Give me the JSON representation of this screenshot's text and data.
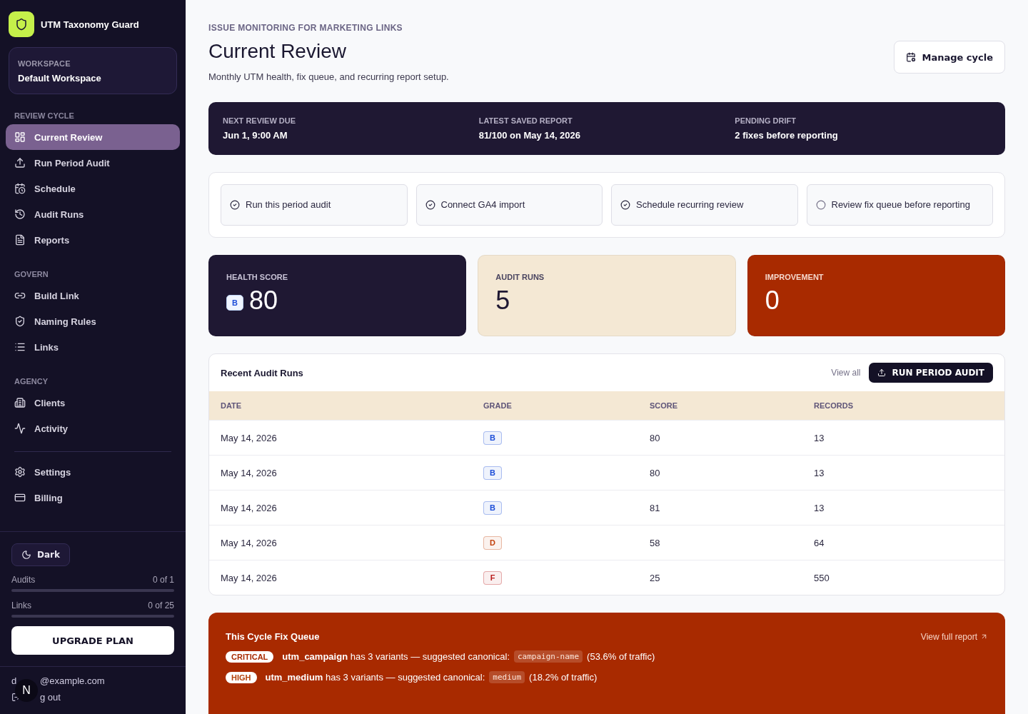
{
  "brand": {
    "name": "UTM Taxonomy Guard"
  },
  "workspace": {
    "label": "WORKSPACE",
    "name": "Default Workspace"
  },
  "nav_sections": [
    {
      "title": "REVIEW CYCLE",
      "items": [
        {
          "label": "Current Review",
          "selected": true
        },
        {
          "label": "Run Period Audit",
          "selected": false
        },
        {
          "label": "Schedule",
          "selected": false
        },
        {
          "label": "Audit Runs",
          "selected": false
        },
        {
          "label": "Reports",
          "selected": false
        }
      ]
    },
    {
      "title": "GOVERN",
      "items": [
        {
          "label": "Build Link",
          "selected": false
        },
        {
          "label": "Naming Rules",
          "selected": false
        },
        {
          "label": "Links",
          "selected": false
        }
      ]
    },
    {
      "title": "AGENCY",
      "items": [
        {
          "label": "Clients",
          "selected": false
        },
        {
          "label": "Activity",
          "selected": false
        }
      ]
    }
  ],
  "nav_footer_items": [
    {
      "label": "Settings",
      "selected": false
    },
    {
      "label": "Billing",
      "selected": false
    }
  ],
  "theme_button": "Dark",
  "usage": [
    {
      "label": "Audits",
      "reading": "0 of 1"
    },
    {
      "label": "Links",
      "reading": "0 of 25"
    }
  ],
  "upgrade_button": "UPGRADE PLAN",
  "account": {
    "email_start": "d",
    "email_end": "@example.com",
    "logout": "g out",
    "badge": "N"
  },
  "header": {
    "eyebrow": "ISSUE MONITORING FOR MARKETING LINKS",
    "title": "Current Review",
    "subtitle": "Monthly UTM health, fix queue, and recurring report setup.",
    "button": "Manage cycle"
  },
  "summary": [
    {
      "label": "NEXT REVIEW DUE",
      "value": "Jun 1, 9:00 AM"
    },
    {
      "label": "LATEST SAVED REPORT",
      "value": "81/100 on May 14, 2026"
    },
    {
      "label": "PENDING DRIFT",
      "value": "2 fixes before reporting"
    }
  ],
  "checklist": [
    {
      "label": "Run this period audit",
      "checked": true
    },
    {
      "label": "Connect GA4 import",
      "checked": true
    },
    {
      "label": "Schedule recurring review",
      "checked": true
    },
    {
      "label": "Review fix queue before reporting",
      "checked": false
    }
  ],
  "stats": [
    {
      "kind": "dark",
      "label": "HEALTH SCORE",
      "value": "80",
      "grade": "B"
    },
    {
      "kind": "cream",
      "label": "AUDIT RUNS",
      "value": "5"
    },
    {
      "kind": "rust",
      "label": "IMPROVEMENT",
      "value": "0"
    }
  ],
  "recent_runs": {
    "title": "Recent Audit Runs",
    "view_all": "View all",
    "button": "RUN PERIOD AUDIT",
    "columns": [
      "DATE",
      "GRADE",
      "SCORE",
      "RECORDS"
    ],
    "rows": [
      {
        "date": "May 14, 2026",
        "grade": "B",
        "color": "#1d4ed8",
        "score": "80",
        "records": "13"
      },
      {
        "date": "May 14, 2026",
        "grade": "B",
        "color": "#1d4ed8",
        "score": "80",
        "records": "13"
      },
      {
        "date": "May 14, 2026",
        "grade": "B",
        "color": "#1d4ed8",
        "score": "81",
        "records": "13"
      },
      {
        "date": "May 14, 2026",
        "grade": "D",
        "color": "#c2410c",
        "score": "58",
        "records": "64"
      },
      {
        "date": "May 14, 2026",
        "grade": "F",
        "color": "#b91c1c",
        "score": "25",
        "records": "550"
      }
    ]
  },
  "fix_queue": {
    "title": "This Cycle Fix Queue",
    "link": "View full report",
    "items": [
      {
        "severity": "CRITICAL",
        "text": "**utm_campaign** has 3 variants — suggested canonical:",
        "code": "campaign-name",
        "share": "(53.6% of traffic)"
      },
      {
        "severity": "HIGH",
        "text": "**utm_medium** has 3 variants — suggested canonical:",
        "code": "medium",
        "share": "(18.2% of traffic)"
      }
    ]
  }
}
